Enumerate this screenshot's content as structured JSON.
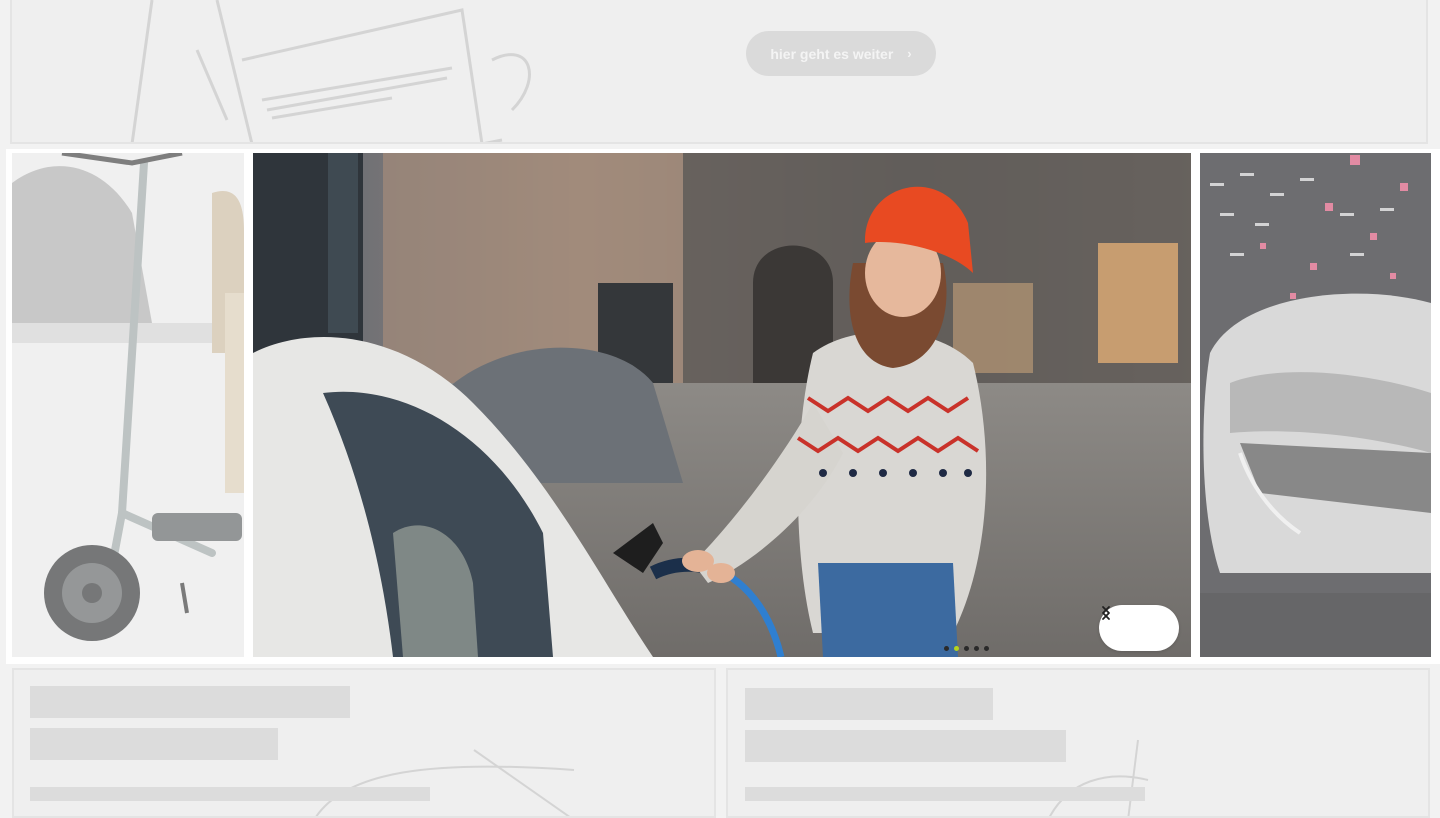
{
  "hero": {
    "cta_label": "hier geht es weiter",
    "cta_arrow": "›"
  },
  "carousel": {
    "slide_count": 5,
    "active_slide": 2,
    "slides": [
      {
        "name": "e-scooter",
        "state": "previous"
      },
      {
        "name": "woman-charging-electric-car",
        "state": "active"
      },
      {
        "name": "electric-sports-car",
        "state": "next"
      }
    ],
    "icons": {
      "prev": "chevron-left-icon",
      "next": "chevron-right-icon"
    },
    "colors": {
      "active_dot": "#b6d31c",
      "inactive_dot": "#2a2a2a"
    }
  }
}
